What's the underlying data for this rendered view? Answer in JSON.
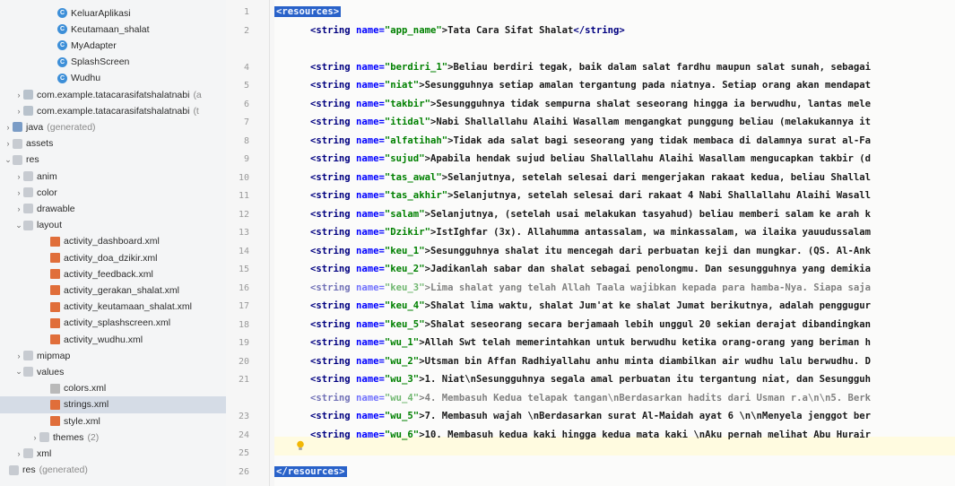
{
  "sidebar": {
    "items": [
      {
        "label": "KeluarAplikasi"
      },
      {
        "label": "Keutamaan_shalat"
      },
      {
        "label": "MyAdapter"
      },
      {
        "label": "SplashScreen"
      },
      {
        "label": "Wudhu"
      },
      {
        "label": "com.example.tatacarasifatshalatnabi",
        "suffix": "(a"
      },
      {
        "label": "com.example.tatacarasifatshalatnabi",
        "suffix": "(t"
      },
      {
        "label": "java",
        "suffix": "(generated)"
      },
      {
        "label": "assets"
      },
      {
        "label": "res"
      },
      {
        "label": "anim"
      },
      {
        "label": "color"
      },
      {
        "label": "drawable"
      },
      {
        "label": "layout"
      },
      {
        "label": "activity_dashboard.xml"
      },
      {
        "label": "activity_doa_dzikir.xml"
      },
      {
        "label": "activity_feedback.xml"
      },
      {
        "label": "activity_gerakan_shalat.xml"
      },
      {
        "label": "activity_keutamaan_shalat.xml"
      },
      {
        "label": "activity_splashscreen.xml"
      },
      {
        "label": "activity_wudhu.xml"
      },
      {
        "label": "mipmap"
      },
      {
        "label": "values"
      },
      {
        "label": "colors.xml"
      },
      {
        "label": "strings.xml"
      },
      {
        "label": "style.xml"
      },
      {
        "label": "themes",
        "suffix": "(2)"
      },
      {
        "label": "xml"
      },
      {
        "label": "res",
        "suffix": "(generated)"
      }
    ]
  },
  "editor": {
    "line_numbers": [
      "1",
      "2",
      "",
      "4",
      "5",
      "6",
      "7",
      "8",
      "9",
      "10",
      "11",
      "12",
      "13",
      "14",
      "15",
      "16",
      "17",
      "18",
      "19",
      "20",
      "21",
      "",
      "23",
      "24",
      "25",
      "26"
    ],
    "open_tag": "<resources>",
    "close_tag": "</resources>",
    "tag_open": "<string ",
    "attr_name": "name=",
    "tag_close": "</string>",
    "app_name": {
      "key": "\"app_name\"",
      "text": ">Tata Cara Sifat Shalat"
    },
    "strings": [
      {
        "key": "\"berdiri_1\"",
        "text": ">Beliau berdiri tegak, baik dalam salat fardhu maupun salat sunah, sebagai"
      },
      {
        "key": "\"niat\"",
        "text": ">Sesungguhnya setiap amalan tergantung pada niatnya. Setiap orang akan mendapat"
      },
      {
        "key": "\"takbir\"",
        "text": ">Sesungguhnya tidak sempurna shalat seseorang hingga ia berwudhu, lantas mele"
      },
      {
        "key": "\"itidal\"",
        "text": ">Nabi Shallallahu Alaihi Wasallam mengangkat punggung beliau (melakukannya it"
      },
      {
        "key": "\"alfatihah\"",
        "text": ">Tidak ada salat bagi seseorang yang tidak membaca di dalamnya surat al-Fa"
      },
      {
        "key": "\"sujud\"",
        "text": ">Apabila hendak sujud beliau Shallallahu Alaihi Wasallam mengucapkan takbir (d"
      },
      {
        "key": "\"tas_awal\"",
        "text": ">Selanjutnya, setelah selesai dari mengerjakan rakaat kedua, beliau Shallal"
      },
      {
        "key": "\"tas_akhir\"",
        "text": ">Selanjutnya, setelah selesai dari rakaat 4 Nabi Shallallahu Alaihi Wasall"
      },
      {
        "key": "\"salam\"",
        "text": ">Selanjutnya, (setelah usai melakukan tasyahud) beliau memberi salam ke arah k"
      },
      {
        "key": "\"Dzikir\"",
        "text": ">IstIghfar (3x). Allahumma antassalam, wa minkassalam, wa ilaika yauudussalam"
      },
      {
        "key": "\"keu_1\"",
        "text": ">Sesungguhnya shalat itu mencegah dari perbuatan keji dan mungkar. (QS. Al-Ank"
      },
      {
        "key": "\"keu_2\"",
        "text": ">Jadikanlah sabar dan shalat sebagai penolongmu. Dan sesungguhnya yang demikia"
      },
      {
        "key": "\"keu_3\"",
        "text": ">Lima shalat yang telah Allah Taala wajibkan kepada para hamba-Nya. Siapa saja"
      },
      {
        "key": "\"keu_4\"",
        "text": ">Shalat lima waktu, shalat Jum'at ke shalat Jumat berikutnya, adalah penggugur"
      },
      {
        "key": "\"keu_5\"",
        "text": ">Shalat seseorang secara berjamaah lebih unggul 20 sekian derajat dibandingkan"
      },
      {
        "key": "\"wu_1\"",
        "text": ">Allah Swt telah memerintahkan untuk berwudhu ketika orang-orang yang beriman h"
      },
      {
        "key": "\"wu_2\"",
        "text": ">Utsman bin Affan Radhiyallahu anhu minta diambilkan air wudhu lalu berwudhu. D"
      },
      {
        "key": "\"wu_3\"",
        "text": ">1. Niat\\nSesungguhnya segala amal perbuatan itu tergantung niat, dan Sesungguh"
      },
      {
        "key": "\"wu_4\"",
        "text": ">4. Membasuh Kedua telapak tangan\\nBerdasarkan hadits dari Usman r.a\\n\\n5. Berk"
      },
      {
        "key": "\"wu_5\"",
        "text": ">7. Membasuh wajah \\nBerdasarkan surat Al-Maidah ayat 6 \\n\\nMenyela jenggot ber"
      },
      {
        "key": "\"wu_6\"",
        "text": ">10. Membasuh kedua kaki hingga kedua mata kaki \\nAku pernah melihat Abu Hurair"
      }
    ]
  }
}
